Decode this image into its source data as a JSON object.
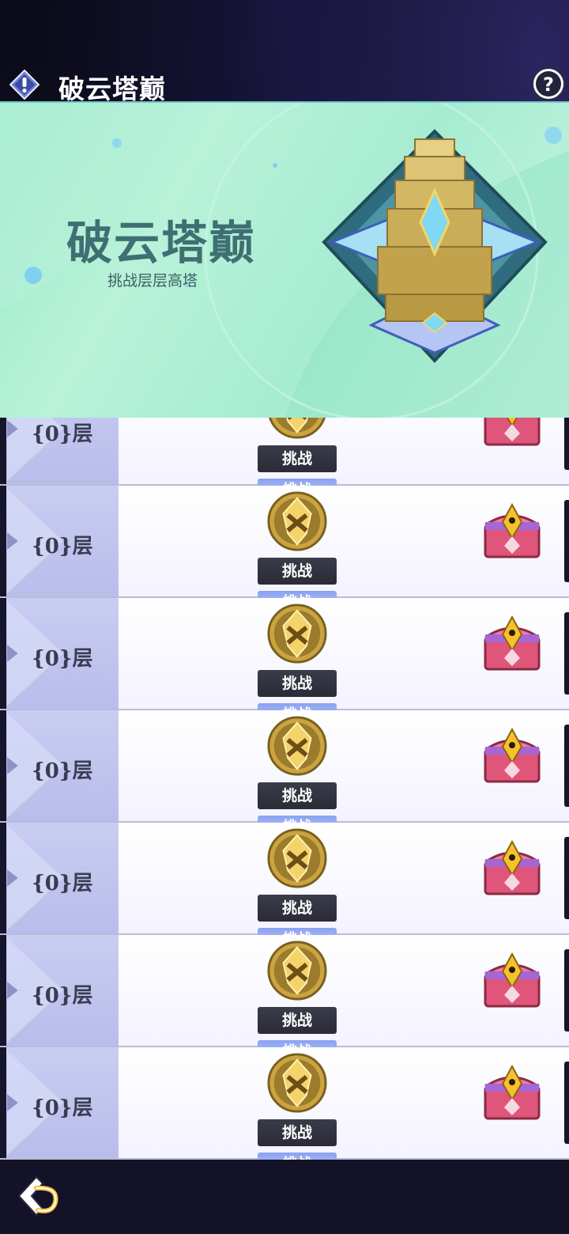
{
  "header": {
    "title": "破云塔巅",
    "info_icon": "exclamation-icon",
    "help_icon": "question-icon"
  },
  "banner": {
    "title": "破云塔巅",
    "subtitle": "挑战层层高塔",
    "emblem": "tower-emblem"
  },
  "floors": [
    {
      "label": "{0}层",
      "challenge_label": "挑战",
      "next_challenge_label": "挑战"
    },
    {
      "label": "{0}层",
      "challenge_label": "挑战",
      "next_challenge_label": "挑战"
    },
    {
      "label": "{0}层",
      "challenge_label": "挑战",
      "next_challenge_label": "挑战"
    },
    {
      "label": "{0}层",
      "challenge_label": "挑战",
      "next_challenge_label": "挑战"
    },
    {
      "label": "{0}层",
      "challenge_label": "挑战",
      "next_challenge_label": "挑战"
    },
    {
      "label": "{0}层",
      "challenge_label": "挑战",
      "next_challenge_label": "挑战"
    },
    {
      "label": "{0}层",
      "challenge_label": "挑战",
      "next_challenge_label": "挑战"
    }
  ],
  "footer": {
    "back_icon": "back-arrow-icon"
  },
  "colors": {
    "banner_text": "#3f6f72",
    "floor_panel": "#c3c7ee",
    "button_dark": "#2f303c",
    "button_light": "#9fb2f4",
    "badge_gold": "#c9a440"
  }
}
